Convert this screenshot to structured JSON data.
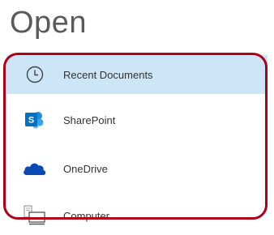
{
  "page": {
    "title": "Open"
  },
  "locations": [
    {
      "label": "Recent Documents",
      "icon": "clock-icon",
      "selected": true
    },
    {
      "label": "SharePoint",
      "icon": "sharepoint-icon",
      "selected": false
    },
    {
      "label": "OneDrive",
      "icon": "cloud-icon",
      "selected": false
    },
    {
      "label": "Computer",
      "icon": "computer-icon",
      "selected": false
    }
  ],
  "colors": {
    "selected_background": "#cde6f7",
    "highlight_border": "#b00016",
    "sharepoint_blue": "#0072c6",
    "onedrive_blue": "#094ab2"
  }
}
